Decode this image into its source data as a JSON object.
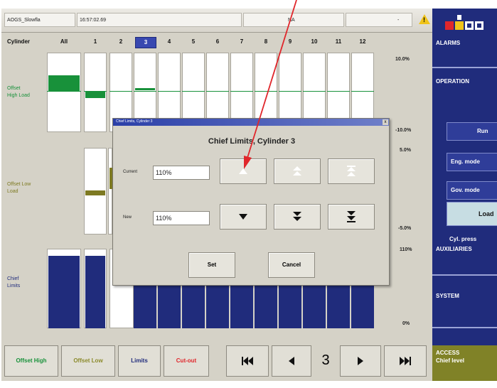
{
  "titlebar": {
    "app_name": "AOGS_Slowfla",
    "time": "16:57:02.69",
    "mode": "NA",
    "dash": "-",
    "warn_glyph": "!"
  },
  "grid": {
    "corner_label": "Cylinder",
    "columns": [
      "All",
      "1",
      "2",
      "3",
      "4",
      "5",
      "6",
      "7",
      "8",
      "9",
      "10",
      "11",
      "12"
    ],
    "selected_column": "3",
    "offset_high": {
      "label_line1": "Offset",
      "label_line2": "High Load",
      "top_pct": "10.0%",
      "bottom_pct": "-10.0%",
      "color": "#18913a"
    },
    "offset_low": {
      "label_line1": "Offset Low",
      "label_line2": "Load",
      "top_pct": "5.0%",
      "bottom_pct": "-5.0%",
      "color": "#7e7a22"
    },
    "chief_limits": {
      "label_line1": "Chief",
      "label_line2": "Limits",
      "top_pct": "110%",
      "bottom_pct": "0%",
      "color": "#202c7c"
    }
  },
  "sidebar": {
    "alarms": "ALARMS",
    "operation": "OPERATION",
    "run_button": "Run",
    "eng_mode": "Eng. mode",
    "gov_mode": "Gov. mode",
    "load_button": "Load",
    "cyl_press": "Cyl. press",
    "auxiliaries": "AUXILIARIES",
    "system": "SYSTEM",
    "access_line1": "ACCESS",
    "access_line2": "Chief level",
    "accent": "#202c7c",
    "access_color": "#808227"
  },
  "bottom_bar": {
    "offset_high": "Offset High",
    "offset_low": "Offset Low",
    "limits": "Limits",
    "cut_out": "Cut-out",
    "page_number": "3",
    "offset_high_color": "#18913a",
    "offset_low_color": "#8b8a2b",
    "limits_color": "#202c7c",
    "cut_out_color": "#e0262b"
  },
  "dialog": {
    "window_title": "Chief Limits, Cylinder 3",
    "heading": "Chief Limits, Cylinder 3",
    "close_glyph": "x",
    "current_label": "Current",
    "current_value": "110%",
    "new_label": "New",
    "new_value": "110%",
    "set_button": "Set",
    "cancel_button": "Cancel"
  },
  "annotation": {
    "arrow_color": "#e0262b"
  }
}
